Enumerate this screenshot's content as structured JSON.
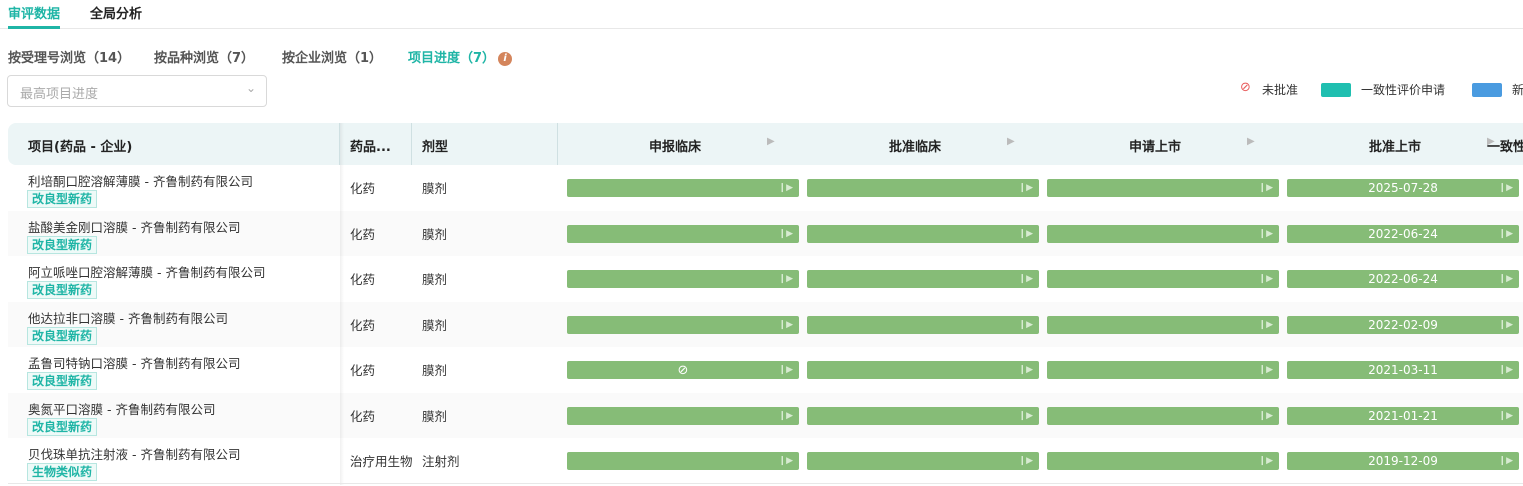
{
  "tabs": [
    "审评数据",
    "全局分析"
  ],
  "subtabs": [
    "按受理号浏览（14）",
    "按品种浏览（7）",
    "按企业浏览（1）",
    "项目进度（7）"
  ],
  "info_icon": "i",
  "filter": {
    "placeholder": "最高项目进度"
  },
  "legend": [
    {
      "label": "未批准",
      "icon": "ban-icon"
    },
    {
      "label": "一致性评价申请",
      "color": "#1fbfb0"
    },
    {
      "label": "新",
      "color": "#4a9be0"
    }
  ],
  "columns": {
    "project": "项目(药品 - 企业)",
    "type": "药品...",
    "dosage": "剂型",
    "stages": [
      "申报临床",
      "批准临床",
      "申请上市",
      "批准上市",
      "一致性"
    ]
  },
  "bar_color": "#86bc77",
  "rows": [
    {
      "name": "利培酮口腔溶解薄膜 - 齐鲁制药有限公司",
      "tag": "改良型新药",
      "type": "化药",
      "dosage": "膜剂",
      "date": "2025-07-28",
      "rejected": false
    },
    {
      "name": "盐酸美金刚口溶膜 - 齐鲁制药有限公司",
      "tag": "改良型新药",
      "type": "化药",
      "dosage": "膜剂",
      "date": "2022-06-24",
      "rejected": false
    },
    {
      "name": "阿立哌唑口腔溶解薄膜 - 齐鲁制药有限公司",
      "tag": "改良型新药",
      "type": "化药",
      "dosage": "膜剂",
      "date": "2022-06-24",
      "rejected": false
    },
    {
      "name": "他达拉非口溶膜 - 齐鲁制药有限公司",
      "tag": "改良型新药",
      "type": "化药",
      "dosage": "膜剂",
      "date": "2022-02-09",
      "rejected": false
    },
    {
      "name": "孟鲁司特钠口溶膜 - 齐鲁制药有限公司",
      "tag": "改良型新药",
      "type": "化药",
      "dosage": "膜剂",
      "date": "2021-03-11",
      "rejected": true
    },
    {
      "name": "奥氮平口溶膜 - 齐鲁制药有限公司",
      "tag": "改良型新药",
      "type": "化药",
      "dosage": "膜剂",
      "date": "2021-01-21",
      "rejected": false
    },
    {
      "name": "贝伐珠单抗注射液 - 齐鲁制药有限公司",
      "tag": "生物类似药",
      "type": "治疗用生物",
      "dosage": "注射剂",
      "date": "2019-12-09",
      "rejected": false
    }
  ]
}
